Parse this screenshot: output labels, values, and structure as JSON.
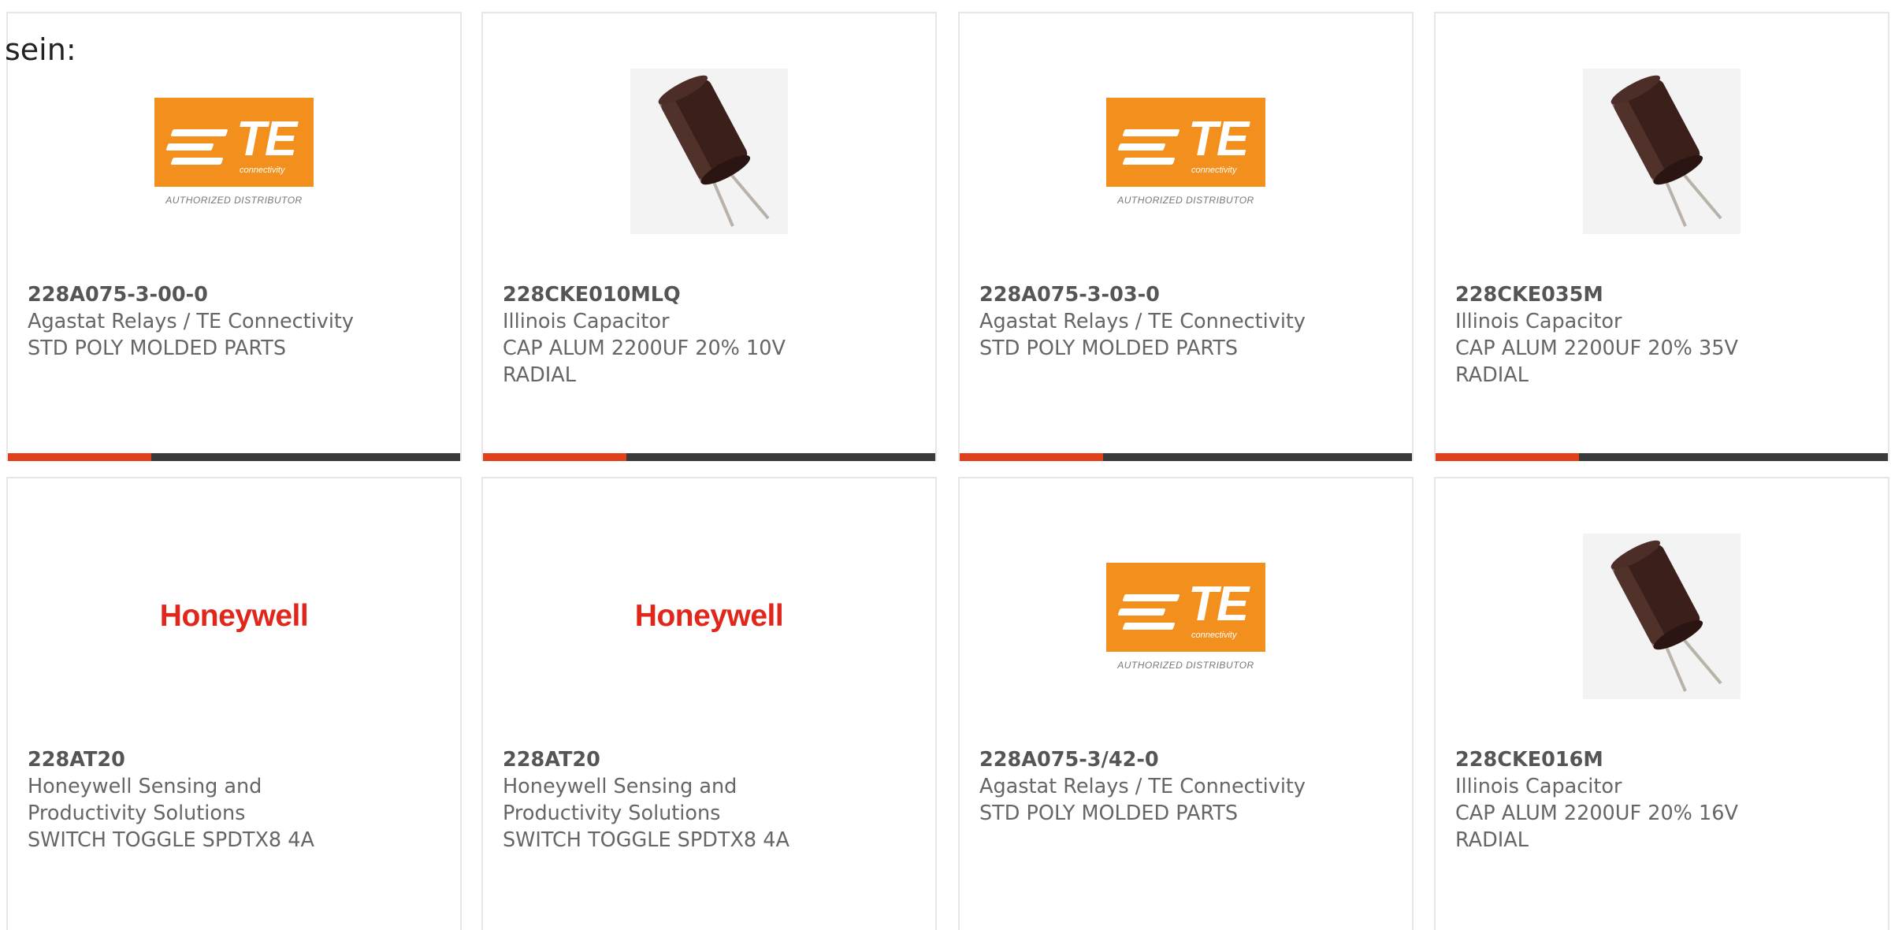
{
  "intro_text": "sein:",
  "colors": {
    "accent": "#e0411b",
    "bar": "#3a3a3a",
    "te_orange": "#f3901d",
    "honeywell_red": "#e1261c"
  },
  "te_logo": {
    "mark": "TE",
    "sub": "connectivity",
    "tagline": "AUTHORIZED DISTRIBUTOR"
  },
  "honeywell_logo": {
    "text": "Honeywell"
  },
  "products": [
    {
      "image": "te-logo",
      "part_number": "228A075-3-00-0",
      "manufacturer": "Agastat Relays / TE Connectivity",
      "description": "STD POLY MOLDED PARTS"
    },
    {
      "image": "capacitor",
      "part_number": "228CKE010MLQ",
      "manufacturer": "Illinois Capacitor",
      "description": "CAP ALUM 2200UF 20% 10V RADIAL"
    },
    {
      "image": "te-logo",
      "part_number": "228A075-3-03-0",
      "manufacturer": "Agastat Relays / TE Connectivity",
      "description": "STD POLY MOLDED PARTS"
    },
    {
      "image": "capacitor",
      "part_number": "228CKE035M",
      "manufacturer": "Illinois Capacitor",
      "description": "CAP ALUM 2200UF 20% 35V RADIAL"
    },
    {
      "image": "honeywell-logo",
      "part_number": "228AT20",
      "manufacturer": "Honeywell Sensing and Productivity Solutions",
      "description": "SWITCH TOGGLE SPDTX8 4A"
    },
    {
      "image": "honeywell-logo",
      "part_number": "228AT20",
      "manufacturer": "Honeywell Sensing and Productivity Solutions",
      "description": "SWITCH TOGGLE SPDTX8 4A"
    },
    {
      "image": "te-logo",
      "part_number": "228A075-3/42-0",
      "manufacturer": "Agastat Relays / TE Connectivity",
      "description": "STD POLY MOLDED PARTS"
    },
    {
      "image": "capacitor",
      "part_number": "228CKE016M",
      "manufacturer": "Illinois Capacitor",
      "description": "CAP ALUM 2200UF 20% 16V RADIAL"
    }
  ]
}
